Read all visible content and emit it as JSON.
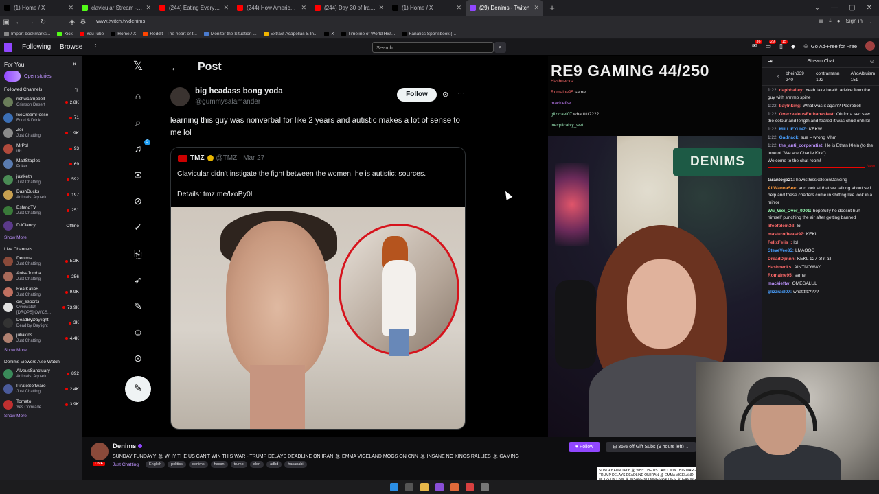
{
  "browser": {
    "tabs": [
      {
        "label": "(1) Home / X",
        "color": "#000000",
        "icon": "x-logo-icon"
      },
      {
        "label": "clavicular Stream - Watch Live o",
        "color": "#53fc18",
        "icon": "kick-icon"
      },
      {
        "label": "(244) Eating Everything At Ame",
        "color": "#ff0000",
        "icon": "youtube-icon"
      },
      {
        "label": "(244) How America's Largest B",
        "color": "#ff0000",
        "icon": "youtube-icon"
      },
      {
        "label": "(244) Day 30 of Iran War: What",
        "color": "#ff0000",
        "icon": "youtube-icon"
      },
      {
        "label": "(1) Home / X",
        "color": "#000000",
        "icon": "x-logo-icon"
      },
      {
        "label": "(29) Denims - Twitch",
        "color": "#9147ff",
        "icon": "twitch-icon",
        "active": true
      }
    ],
    "url": "www.twitch.tv/denims",
    "signin": "Sign in",
    "bookmarks": [
      {
        "label": "Import bookmarks...",
        "color": "#888888"
      },
      {
        "label": "Kick",
        "color": "#53fc18"
      },
      {
        "label": "YouTube",
        "color": "#ff0000"
      },
      {
        "label": "Home / X",
        "color": "#000000"
      },
      {
        "label": "Reddit - The heart of t...",
        "color": "#ff4500"
      },
      {
        "label": "Monitor the Situation ...",
        "color": "#4a7bd0"
      },
      {
        "label": "Extract Acapellas & In...",
        "color": "#f0b400"
      },
      {
        "label": "X",
        "color": "#000000"
      },
      {
        "label": "Timeline of World Hist...",
        "color": "#000000"
      },
      {
        "label": "Fanatics Sportsbook (...",
        "color": "#000000"
      }
    ]
  },
  "twitch_nav": {
    "following": "Following",
    "browse": "Browse",
    "search_placeholder": "Search",
    "badges": {
      "inbox": "36",
      "whispers": "29",
      "notifications": "15"
    },
    "turbo": "Go Ad-Free for Free"
  },
  "sidebar": {
    "for_you": "For You",
    "open_stories": "Open stories",
    "followed_title": "Followed Channels",
    "followed": [
      {
        "name": "richwcampbell",
        "game": "Crimson Desert",
        "viewers": "2.8K",
        "color": "#6a7d5a"
      },
      {
        "name": "IceCreamPosse",
        "game": "Food & Drink",
        "viewers": "71",
        "color": "#3b6fb6"
      },
      {
        "name": "Zoil",
        "game": "Just Chatting",
        "viewers": "1.9K",
        "color": "#8a8a8a"
      },
      {
        "name": "MrPol",
        "game": "IRL",
        "viewers": "93",
        "color": "#b04a3c"
      },
      {
        "name": "MattStaples",
        "game": "Poker",
        "viewers": "69",
        "color": "#5a7bb0"
      },
      {
        "name": "justketh",
        "game": "Just Chatting",
        "viewers": "592",
        "color": "#4a8b55"
      },
      {
        "name": "DashDucks",
        "game": "Animals, Aquariu...",
        "viewers": "197",
        "color": "#c8a050"
      },
      {
        "name": "EsfandTV",
        "game": "Just Chatting",
        "viewers": "251",
        "color": "#3a7a3a"
      },
      {
        "name": "DJCiancy",
        "game": "",
        "viewers": "Offline",
        "color": "#5b3a8a"
      }
    ],
    "show_more": "Show More",
    "live_title": "Live Channels",
    "live": [
      {
        "name": "Denims",
        "game": "Just Chatting",
        "viewers": "5.2K",
        "color": "#8a4a3a"
      },
      {
        "name": "AnisaJomha",
        "game": "Just Chatting",
        "viewers": "256",
        "color": "#a86a5a"
      },
      {
        "name": "RealKatieB",
        "game": "Just Chatting",
        "viewers": "9.9K",
        "color": "#c07060"
      },
      {
        "name": "ow_esports",
        "game": "Overwatch",
        "extra": "[DROPS] OWCS...",
        "viewers": "73.9K",
        "color": "#e0e0e0"
      },
      {
        "name": "DeadByDaylight",
        "game": "Dead by Daylight",
        "viewers": "3K",
        "color": "#333333"
      },
      {
        "name": "juliakins",
        "game": "Just Chatting",
        "viewers": "4.4K",
        "color": "#b08070"
      }
    ],
    "also_title": "Denims Viewers Also Watch",
    "also": [
      {
        "name": "AlveusSanctuary",
        "game": "Animals, Aquariu...",
        "viewers": "892",
        "color": "#3a8a5a"
      },
      {
        "name": "PirateSoftware",
        "game": "Just Chatting",
        "viewers": "2.4K",
        "color": "#4a5a9a"
      },
      {
        "name": "Tomato",
        "game": "Yes Comrade",
        "viewers": "3.9K",
        "color": "#c03030"
      }
    ]
  },
  "x_post": {
    "header": "Post",
    "notif_badge": "3",
    "author_name": "big headass bong yoda",
    "author_handle": "@gummysalamander",
    "follow": "Follow",
    "text": "learning this guy was nonverbal for like 2 years and autistic makes a lot of sense to me lol",
    "quote": {
      "name": "TMZ",
      "meta": "@TMZ · Mar 27",
      "text": "Clavicular didn't instigate the fight between the women, he is autistic: sources.",
      "link": "Details: tmz.me/lxoBy0L"
    }
  },
  "game_overlay": {
    "title": "RE9 GAMING 44/250",
    "chat_lines": [
      {
        "user": "Hashnecks:",
        "text": "",
        "cls": "n1"
      },
      {
        "user": "Romaine95:",
        "text": "same",
        "cls": "n1"
      },
      {
        "user": "mackieftw:",
        "text": "",
        "cls": "n2"
      },
      {
        "user": "glizzrael07:",
        "text": "whatttttt????",
        "cls": "n3"
      },
      {
        "user": "inexplicably_wet:",
        "text": "",
        "cls": "n3"
      }
    ]
  },
  "cam": {
    "sign": "DENIMS"
  },
  "stream_info": {
    "channel": "Denims",
    "live": "LIVE",
    "title": "SUNDAY FUNDAYY 🏝 WHY THE US CAN'T WIN THIS WAR - TRUMP DELAYS DEADLINE ON IRAN 🏝 EMMA VIGELAND MOGS ON CNN 🏝 INSANE NO KINGS RALLIES 🏝 GAMING",
    "category": "Just Chatting",
    "tags": [
      "English",
      "politics",
      "denims",
      "hasan",
      "trump",
      "elon",
      "adhd",
      "hasanabi"
    ],
    "follow": "Follow",
    "gift": "35% off Gift Subs (9 hours left)",
    "tooltip": "SUNDAY FUNDAYY 🏝 WHY THE US CAN'T WIN THIS WAR - TRUMP DELAYS DEADLINE ON IRAN 🏝 EMMA VIGELAND MOGS ON CNN 🏝 INSANE NO KINGS RALLIES 🏝 GAMING"
  },
  "chat": {
    "title": "Stream Chat",
    "leaders": [
      {
        "name": "bhein339",
        "count": "240"
      },
      {
        "name": "contramann",
        "count": "192"
      },
      {
        "name": "AfroAltruism",
        "count": "151"
      }
    ],
    "messages_before": [
      {
        "time": "1:22",
        "user": "daphbailey:",
        "color": "#ff6b6b",
        "text": "Yeah take health advice from the guy with shrimp spine"
      },
      {
        "time": "1:22",
        "user": "baylnking:",
        "color": "#ff6b6b",
        "text": "What was it again? Pedrotroll"
      },
      {
        "time": "1:22",
        "user": "OverzealousEuthanasiast:",
        "color": "#ff6b6b",
        "text": "Oh for a sec saw the colour and length and feared it was chud ohh lol"
      },
      {
        "time": "1:22",
        "user": "MILLIEYUNZ:",
        "color": "#4aa0ff",
        "text": "KEKW"
      },
      {
        "time": "1:22",
        "user": "Gadnack:",
        "color": "#4aa0ff",
        "text": "sue = wrong Mhm"
      },
      {
        "time": "1:22",
        "user": "the_anti_corporatist:",
        "color": "#bf94ff",
        "text": "He is Ethan Klein (to the tune of \"We are Charlie Kirk\")"
      }
    ],
    "welcome": "Welcome to the chat room!",
    "new_label": "New",
    "messages_after": [
      {
        "user": "tarantoga21:",
        "color": "#efeff1",
        "text": "howisthisskeletonDancing"
      },
      {
        "user": "AllWannaSee:",
        "color": "#ff9a3c",
        "text": "and look at that we talking about self help and these chatters come in shitting like look in a mirror"
      },
      {
        "user": "Wu_Wei_Over_9001:",
        "color": "#9bffb5",
        "text": "hopefully he doesnt hurt himself punching the air after getting banned"
      },
      {
        "user": "lifeofplein3d:",
        "color": "#ff6b6b",
        "text": "lol"
      },
      {
        "user": "masterofbeast97:",
        "color": "#ff6b6b",
        "text": "KEKL"
      },
      {
        "user": "FelixFelis_:",
        "color": "#ff6b6b",
        "text": "lol"
      },
      {
        "user": "SteveVee85:",
        "color": "#4aa0ff",
        "text": "LMAOOO"
      },
      {
        "user": "DreadDjinnn:",
        "color": "#ff6b6b",
        "text": "KEKL 127 of it all"
      },
      {
        "user": "Hashnecks:",
        "color": "#ff6b6b",
        "text": "AINTNOWAY"
      },
      {
        "user": "Romaine95:",
        "color": "#ff6b6b",
        "text": "same"
      },
      {
        "user": "mackieftw:",
        "color": "#bf94ff",
        "text": "OMEGALUL"
      },
      {
        "user": "glizzrael07:",
        "color": "#4aa0ff",
        "text": "whatttttt????"
      }
    ]
  }
}
